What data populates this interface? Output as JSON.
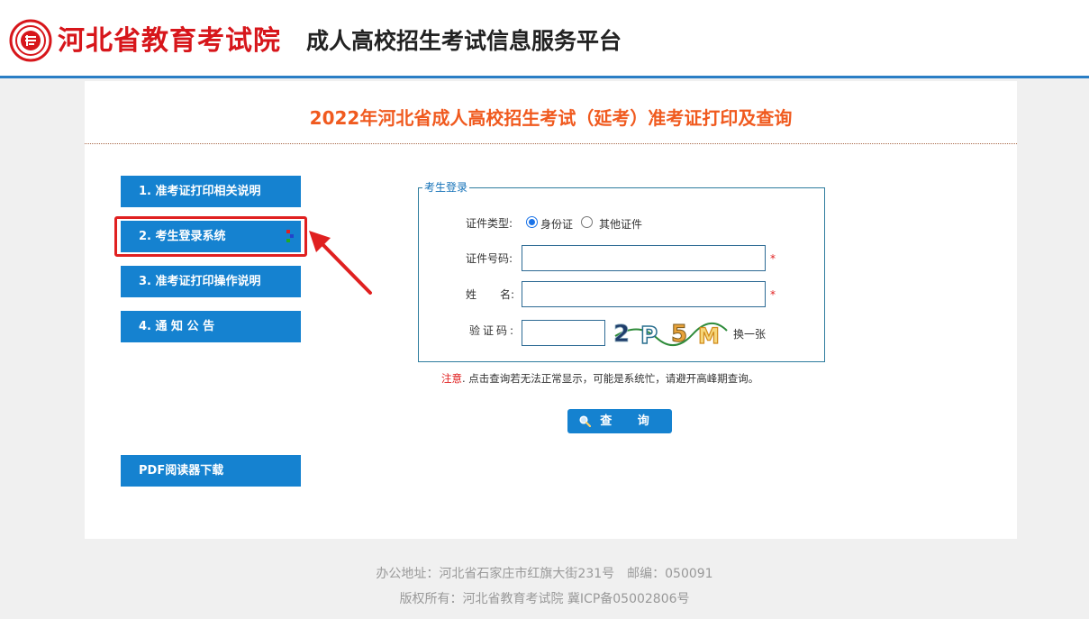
{
  "header": {
    "org_name": "河北省教育考试院",
    "platform_name": "成人高校招生考试信息服务平台",
    "brand_color": "#d7161b",
    "accent_color": "#2a7ec5"
  },
  "page": {
    "title": "2022年河北省成人高校招生考试（延考）准考证打印及查询"
  },
  "menu": {
    "items": [
      {
        "label": "1. 准考证打印相关说明"
      },
      {
        "label": "2. 考生登录系统"
      },
      {
        "label": "3. 准考证打印操作说明"
      },
      {
        "label": "4. 通 知 公 告"
      }
    ],
    "pdf_label": "PDF阅读器下载",
    "selected_index": 1
  },
  "login": {
    "legend": "考生登录",
    "id_type_label": "证件类型:",
    "id_type_options": [
      "身份证",
      "其他证件"
    ],
    "id_type_selected": "身份证",
    "id_number_label": "证件号码:",
    "id_number_value": "",
    "name_label_a": "姓",
    "name_label_b": "名:",
    "name_value": "",
    "captcha_label": "验证码:",
    "captcha_value": "",
    "captcha_text": "2P5M",
    "refresh_label": "换一张",
    "required_mark": "*"
  },
  "notice": {
    "highlight": "注意",
    "text": ". 点击查询若无法正常显示，可能是系统忙，请避开高峰期查询。"
  },
  "query_button": {
    "label": "查 询",
    "icon": "search-icon"
  },
  "footer": {
    "address": "办公地址：河北省石家庄市红旗大街231号　邮编：050091",
    "copyright": "版权所有：河北省教育考试院 冀ICP备05002806号"
  }
}
